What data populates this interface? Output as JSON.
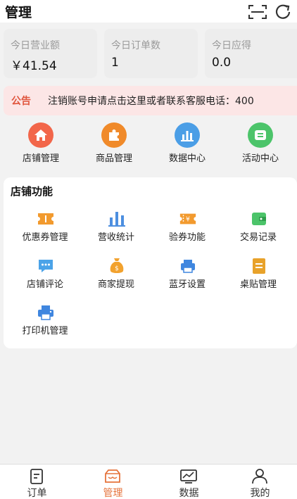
{
  "header": {
    "title": "管理"
  },
  "stats": [
    {
      "label": "今日营业额",
      "value": "￥41.54"
    },
    {
      "label": "今日订单数",
      "value": "1"
    },
    {
      "label": "今日应得",
      "value": "0.0"
    }
  ],
  "notice": {
    "tag": "公告",
    "text": "注销账号申请点击这里或者联系客服电话：400"
  },
  "quick": [
    {
      "label": "店铺管理",
      "icon": "home-icon",
      "color": "#f2664a"
    },
    {
      "label": "商品管理",
      "icon": "puzzle-icon",
      "color": "#f08a2a"
    },
    {
      "label": "数据中心",
      "icon": "bar-chart-icon",
      "color": "#4b9ee6"
    },
    {
      "label": "活动中心",
      "icon": "toggle-icon",
      "color": "#4cc46a"
    }
  ],
  "store": {
    "title": "店铺功能",
    "items": [
      {
        "label": "优惠券管理",
        "icon": "coupon-icon",
        "color": "#f29a2e"
      },
      {
        "label": "营收统计",
        "icon": "bar-chart-icon",
        "color": "#4d8fe0"
      },
      {
        "label": "验券功能",
        "icon": "ticket-icon",
        "color": "#f29a2e"
      },
      {
        "label": "交易记录",
        "icon": "wallet-icon",
        "color": "#4cc46a"
      },
      {
        "label": "店铺评论",
        "icon": "chat-icon",
        "color": "#4ba3e8"
      },
      {
        "label": "商家提现",
        "icon": "money-bag-icon",
        "color": "#f2a22e"
      },
      {
        "label": "蓝牙设置",
        "icon": "bluetooth-printer-icon",
        "color": "#3f86df"
      },
      {
        "label": "桌贴管理",
        "icon": "sticker-icon",
        "color": "#e8a22a"
      },
      {
        "label": "打印机管理",
        "icon": "printer-icon",
        "color": "#3f86df"
      }
    ]
  },
  "tabbar": [
    {
      "label": "订单",
      "icon": "order-icon"
    },
    {
      "label": "管理",
      "icon": "manage-icon",
      "active": true
    },
    {
      "label": "数据",
      "icon": "data-icon"
    },
    {
      "label": "我的",
      "icon": "profile-icon"
    }
  ],
  "colors": {
    "accent": "#e6733b",
    "notice_bg": "#fce6e6",
    "notice_tag": "#e0553d"
  }
}
